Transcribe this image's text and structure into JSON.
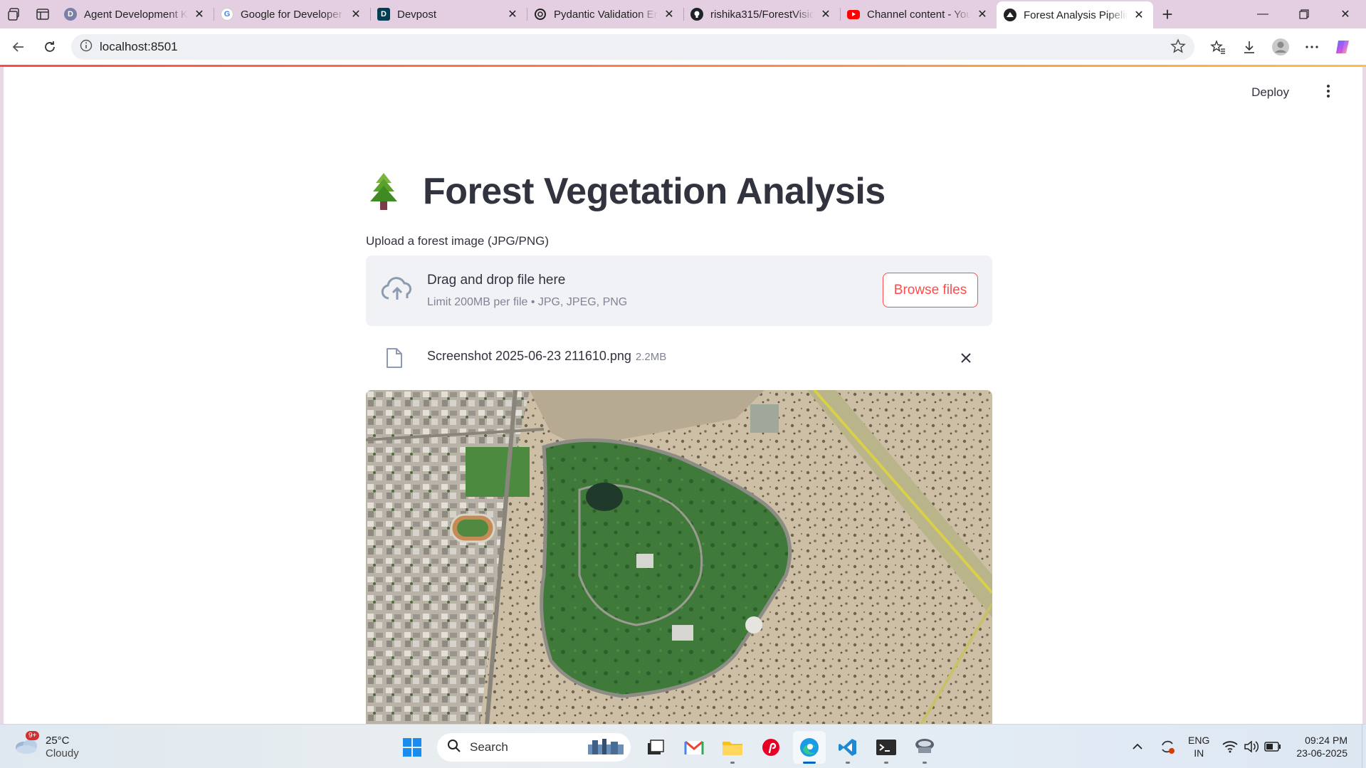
{
  "browser": {
    "tabs": [
      {
        "label": "Agent Development K",
        "favicon": "D",
        "favicon_color": "#3c3f8f"
      },
      {
        "label": "Google for Developer",
        "favicon": "G",
        "favicon_color": "#ffffff"
      },
      {
        "label": "Devpost",
        "favicon": "D",
        "favicon_color": "#003e54"
      },
      {
        "label": "Pydantic Validation Er",
        "favicon": "openai-icon",
        "favicon_color": "#222222"
      },
      {
        "label": "rishika315/ForestVisio",
        "favicon": "github-icon",
        "favicon_color": "#1f2328"
      },
      {
        "label": "Channel content - You",
        "favicon": "youtube-icon",
        "favicon_color": "#ff0000"
      },
      {
        "label": "Forest Analysis Pipelin",
        "favicon": "streamlit-icon",
        "favicon_color": "#222222",
        "active": true
      }
    ],
    "url": "localhost:8501"
  },
  "app": {
    "deploy_label": "Deploy",
    "title": "Forest Vegetation Analysis",
    "title_icon": "evergreen-tree-icon",
    "uploader": {
      "label": "Upload a forest image (JPG/PNG)",
      "drop_text": "Drag and drop file here",
      "limit_text": "Limit 200MB per file • JPG, JPEG, PNG",
      "browse_label": "Browse files"
    },
    "file": {
      "name": "Screenshot 2025-06-23 211610.png",
      "size": "2.2MB"
    }
  },
  "taskbar": {
    "weather": {
      "temp": "25°C",
      "condition": "Cloudy",
      "badge": "9+"
    },
    "search_placeholder": "Search",
    "language": {
      "line1": "ENG",
      "line2": "IN"
    },
    "clock": {
      "time": "09:24 PM",
      "date": "23-06-2025"
    }
  },
  "colors": {
    "accent": "#ff4b4b",
    "text": "#31333f",
    "muted": "#808495",
    "dropzone_bg": "#f0f2f6"
  }
}
